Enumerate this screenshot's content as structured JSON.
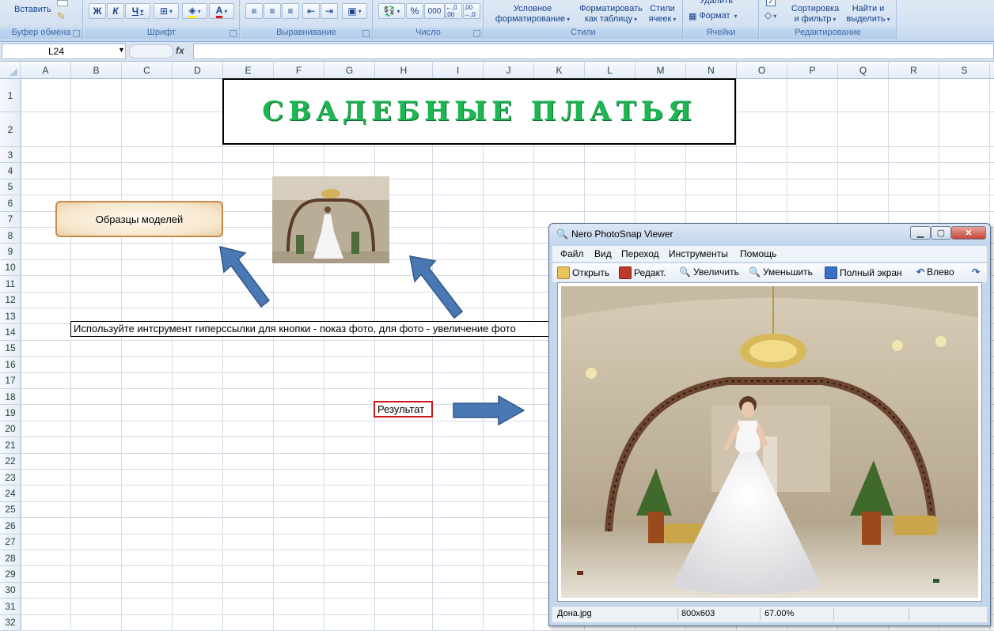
{
  "ribbon": {
    "clipboard": {
      "paste": "Вставить",
      "title": "Буфер обмена"
    },
    "font": {
      "title": "Шрифт",
      "bold": "Ж",
      "italic": "К",
      "underline": "Ч"
    },
    "alignment": {
      "title": "Выравнивание"
    },
    "number": {
      "title": "Число",
      "percent": "%",
      "thousands": "000",
      "inc_decimal": "←,0 ,00",
      "dec_decimal": ",00 →,0"
    },
    "styles": {
      "title": "Стили",
      "conditional_1": "Условное",
      "conditional_2": "форматирование",
      "as_table_1": "Форматировать",
      "as_table_2": "как таблицу",
      "cell_styles_1": "Стили",
      "cell_styles_2": "ячеек"
    },
    "cells": {
      "title": "Ячейки",
      "delete": "Удалить",
      "format": "Формат"
    },
    "editing": {
      "title": "Редактирование",
      "sort_1": "Сортировка",
      "sort_2": "и фильтр",
      "find_1": "Найти и",
      "find_2": "выделить"
    }
  },
  "formula_bar": {
    "name_box": "L24",
    "fx": "fx",
    "value": ""
  },
  "sheet": {
    "columns": [
      "A",
      "B",
      "C",
      "D",
      "E",
      "F",
      "G",
      "H",
      "I",
      "J",
      "K",
      "L",
      "M",
      "N",
      "O",
      "P",
      "Q",
      "R",
      "S"
    ],
    "rows": [
      "1",
      "2",
      "3",
      "4",
      "5",
      "6",
      "7",
      "8",
      "9",
      "10",
      "11",
      "12",
      "13",
      "14",
      "15",
      "16",
      "17",
      "18",
      "19",
      "20",
      "21",
      "22",
      "23",
      "24",
      "25",
      "26",
      "27",
      "28",
      "29",
      "30",
      "31",
      "32"
    ],
    "title_art": "СВАДЕБНЫЕ ПЛАТЬЯ",
    "models_button": "Образцы моделей",
    "instruction": "Используйте интсрумент гиперссылки для кнопки - показ фото, для фото - увеличение фото",
    "result_label": "Результат"
  },
  "viewer": {
    "title": "Nero PhotoSnap Viewer",
    "menu": [
      "Файл",
      "Вид",
      "Переход",
      "Инструменты",
      "Помощь"
    ],
    "toolbar": {
      "open": "Открыть",
      "edit": "Редакт.",
      "zoom_in": "Увеличить",
      "zoom_out": "Уменьшить",
      "fullscreen": "Полный экран",
      "rotate_left": "Влево"
    },
    "status": {
      "filename": "Дона.jpg",
      "dimensions": "800x603",
      "zoom": "67.00%"
    }
  },
  "colors": {
    "title_green": "#1db652",
    "arrow_blue": "#4a78b5",
    "result_border": "#d01818"
  }
}
